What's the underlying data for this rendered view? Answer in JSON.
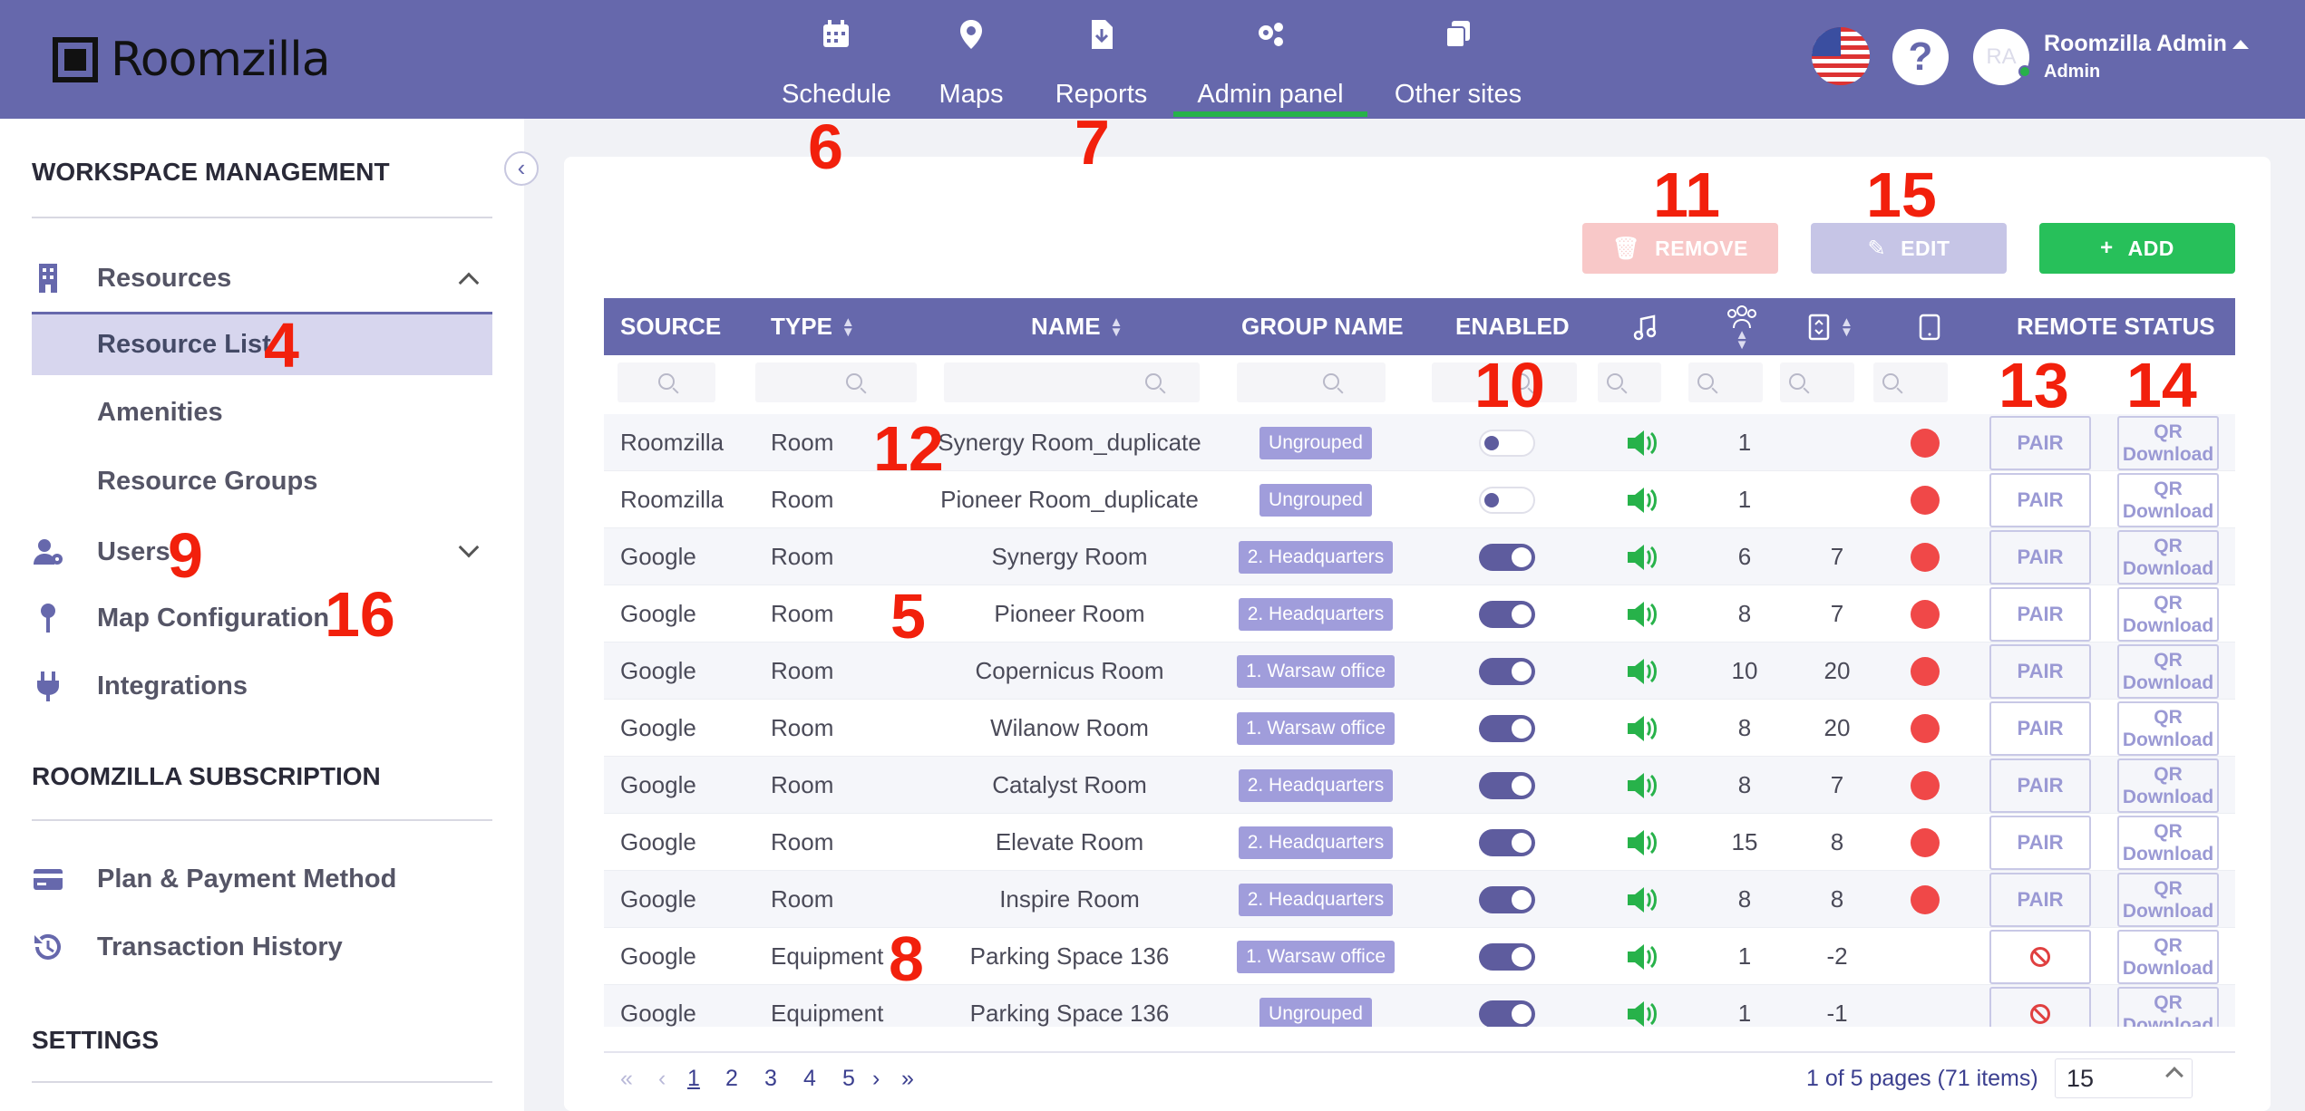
{
  "app": {
    "logo_text": "Roomzilla"
  },
  "topnav": {
    "items": [
      {
        "label": "Schedule",
        "icon": "calendar-icon"
      },
      {
        "label": "Maps",
        "icon": "map-pin-icon"
      },
      {
        "label": "Reports",
        "icon": "file-download-icon"
      },
      {
        "label": "Admin panel",
        "icon": "gears-icon"
      },
      {
        "label": "Other sites",
        "icon": "copy-icon"
      }
    ],
    "active": "Admin panel"
  },
  "user": {
    "initials": "RA",
    "name": "Roomzilla Admin",
    "role": "Admin",
    "language_icon": "us-flag-icon",
    "help_label": "?"
  },
  "sidebar": {
    "workspace_heading": "WORKSPACE MANAGEMENT",
    "resources": "Resources",
    "resource_list": "Resource List",
    "amenities": "Amenities",
    "resource_groups": "Resource Groups",
    "users": "Users",
    "map_configuration": "Map Configuration",
    "integrations": "Integrations",
    "subscription_heading": "ROOMZILLA SUBSCRIPTION",
    "plan_payment": "Plan & Payment Method",
    "transaction_history": "Transaction History",
    "settings_heading": "SETTINGS"
  },
  "toolbar": {
    "remove": "REMOVE",
    "edit": "EDIT",
    "add": "ADD"
  },
  "table": {
    "headers": {
      "source": "SOURCE",
      "type": "TYPE",
      "name": "NAME",
      "group": "GROUP NAME",
      "enabled": "ENABLED",
      "remote": "REMOTE STATUS"
    },
    "pair_label": "PAIR",
    "qr_line1": "QR",
    "qr_line2": "Download",
    "rows": [
      {
        "source": "Roomzilla",
        "type": "Room",
        "name": "Synergy Room_duplicate",
        "group": "Ungrouped",
        "enabled": false,
        "capacity": "1",
        "floor": "",
        "status": "red",
        "pair": true
      },
      {
        "source": "Roomzilla",
        "type": "Room",
        "name": "Pioneer Room_duplicate",
        "group": "Ungrouped",
        "enabled": false,
        "capacity": "1",
        "floor": "",
        "status": "red",
        "pair": true
      },
      {
        "source": "Google",
        "type": "Room",
        "name": "Synergy Room",
        "group": "2. Headquarters",
        "enabled": true,
        "capacity": "6",
        "floor": "7",
        "status": "red",
        "pair": true
      },
      {
        "source": "Google",
        "type": "Room",
        "name": "Pioneer Room",
        "group": "2. Headquarters",
        "enabled": true,
        "capacity": "8",
        "floor": "7",
        "status": "red",
        "pair": true
      },
      {
        "source": "Google",
        "type": "Room",
        "name": "Copernicus Room",
        "group": "1. Warsaw office",
        "enabled": true,
        "capacity": "10",
        "floor": "20",
        "status": "red",
        "pair": true
      },
      {
        "source": "Google",
        "type": "Room",
        "name": "Wilanow Room",
        "group": "1. Warsaw office",
        "enabled": true,
        "capacity": "8",
        "floor": "20",
        "status": "red",
        "pair": true
      },
      {
        "source": "Google",
        "type": "Room",
        "name": "Catalyst Room",
        "group": "2. Headquarters",
        "enabled": true,
        "capacity": "8",
        "floor": "7",
        "status": "red",
        "pair": true
      },
      {
        "source": "Google",
        "type": "Room",
        "name": "Elevate Room",
        "group": "2. Headquarters",
        "enabled": true,
        "capacity": "15",
        "floor": "8",
        "status": "red",
        "pair": true
      },
      {
        "source": "Google",
        "type": "Room",
        "name": "Inspire Room",
        "group": "2. Headquarters",
        "enabled": true,
        "capacity": "8",
        "floor": "8",
        "status": "red",
        "pair": true
      },
      {
        "source": "Google",
        "type": "Equipment",
        "name": "Parking Space 136",
        "group": "1. Warsaw office",
        "enabled": true,
        "capacity": "1",
        "floor": "-2",
        "status": "none",
        "pair": false
      },
      {
        "source": "Google",
        "type": "Equipment",
        "name": "Parking Space 136",
        "group": "Ungrouped",
        "enabled": true,
        "capacity": "1",
        "floor": "-1",
        "status": "none",
        "pair": false
      }
    ]
  },
  "pagination": {
    "pages": [
      "1",
      "2",
      "3",
      "4",
      "5"
    ],
    "current": "1",
    "info": "1 of 5 pages (71 items)",
    "page_size": "15"
  },
  "markers": [
    "4",
    "5",
    "6",
    "7",
    "8",
    "9",
    "10",
    "11",
    "12",
    "13",
    "14",
    "15",
    "16"
  ]
}
